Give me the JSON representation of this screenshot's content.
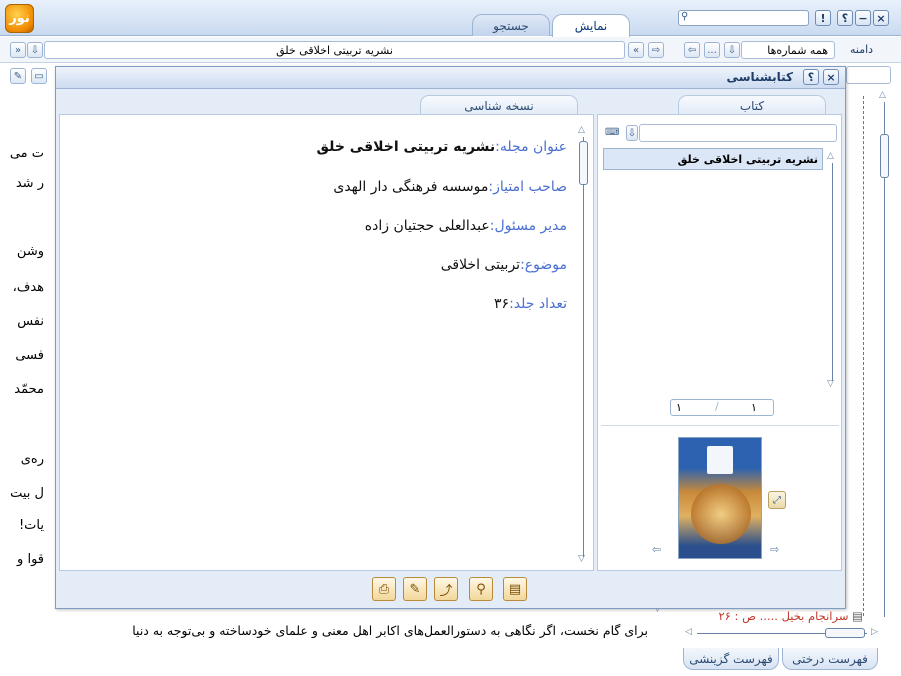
{
  "topbar": {
    "tabs": [
      "نمایش",
      "جستجو"
    ],
    "help_label": "؟",
    "warn_label": "!",
    "minimize_label": "−",
    "close_label": "×"
  },
  "toolbar": {
    "scope_label": "دامنه",
    "scope_value": "همه شماره‌ها",
    "more_label": "...",
    "address": "نشریه تربیتی اخلاقی خلق",
    "back_label": "«",
    "forward_label": "»"
  },
  "background_lines": [
    "ت می",
    "ر شد",
    "وشن",
    "هدف،",
    "نفس",
    "فسی",
    "محمّد",
    "ره‌ی",
    "ل بیت",
    "یات!",
    "قوا و",
    "برای گام نخست، اگر نگاهی به دستورالعمل‌های اکابر اهل معنی و علمای خودساخته و بی‌توجه به دنیا"
  ],
  "right_panel": {
    "list_item": "سرانجام بخیل ..... ص : ۲۶",
    "tabs": [
      "فهرست درختی",
      "فهرست گزینشی"
    ]
  },
  "dialog": {
    "title": "کتابشناسی",
    "help_label": "؟",
    "close_label": "×",
    "book_tab": "کتاب",
    "details_tab": "نسخه شناسی",
    "book_list": [
      "نشریه تربیتی اخلاقی خلق"
    ],
    "pager": {
      "current": "۱",
      "total": "۱"
    },
    "details": [
      {
        "label": "عنوان مجله:",
        "value": "نشریه تربیتی اخلاقی خلق"
      },
      {
        "label": "صاحب امتیاز:",
        "value": "موسسه فرهنگی دار الهدی"
      },
      {
        "label": "مدیر مسئول:",
        "value": "عبدالعلی حجتیان زاده"
      },
      {
        "label": "موضوع:",
        "value": "تربیتی اخلاقی"
      },
      {
        "label": "تعداد جلد:",
        "value": "۳۶"
      }
    ],
    "tool_icons": [
      "print-icon",
      "edit-icon",
      "export-icon",
      "search-icon",
      "note-icon"
    ]
  }
}
